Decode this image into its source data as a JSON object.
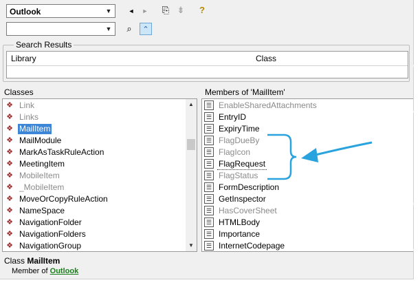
{
  "toolbar": {
    "library_value": "Outlook",
    "search_value": "",
    "back_label": "◄",
    "forward_label": "►",
    "copy_label": "⎘",
    "view_definition_label": "⇟",
    "help_label": "?",
    "search_button_label": "⌕",
    "toggle_results_label": "⌃"
  },
  "search_results": {
    "title": "Search Results",
    "columns": [
      "Library",
      "Class"
    ]
  },
  "classes": {
    "title": "Classes",
    "items": [
      {
        "label": "Link",
        "gray": true
      },
      {
        "label": "Links",
        "gray": true
      },
      {
        "label": "MailItem",
        "selected": true
      },
      {
        "label": "MailModule"
      },
      {
        "label": "MarkAsTaskRuleAction"
      },
      {
        "label": "MeetingItem"
      },
      {
        "label": "MobileItem",
        "gray": true
      },
      {
        "label": "_MobileItem",
        "gray": true
      },
      {
        "label": "MoveOrCopyRuleAction"
      },
      {
        "label": "NameSpace"
      },
      {
        "label": "NavigationFolder"
      },
      {
        "label": "NavigationFolders"
      },
      {
        "label": "NavigationGroup"
      }
    ]
  },
  "members": {
    "title": "Members of 'MailItem'",
    "items": [
      {
        "label": "EnableSharedAttachments",
        "gray": true
      },
      {
        "label": "EntryID"
      },
      {
        "label": "ExpiryTime"
      },
      {
        "label": "FlagDueBy",
        "gray": true
      },
      {
        "label": "FlagIcon",
        "gray": true
      },
      {
        "label": "FlagRequest",
        "focused": true
      },
      {
        "label": "FlagStatus",
        "gray": true
      },
      {
        "label": "FormDescription"
      },
      {
        "label": "GetInspector"
      },
      {
        "label": "HasCoverSheet",
        "gray": true
      },
      {
        "label": "HTMLBody"
      },
      {
        "label": "Importance"
      },
      {
        "label": "InternetCodepage"
      }
    ]
  },
  "details": {
    "class_prefix": "Class ",
    "class_name": "MailItem",
    "member_of_prefix": "Member of ",
    "library_link": "Outlook"
  },
  "colors": {
    "selection": "#3b86d6",
    "annotation": "#29a3dd",
    "link": "#1a7f1a"
  }
}
